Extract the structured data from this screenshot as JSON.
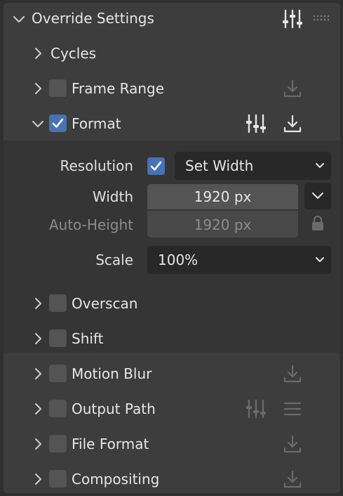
{
  "header": {
    "title": "Override Settings"
  },
  "rows": {
    "cycles": {
      "label": "Cycles"
    },
    "frame_range": {
      "label": "Frame Range"
    },
    "format": {
      "label": "Format"
    },
    "overscan": {
      "label": "Overscan"
    },
    "shift": {
      "label": "Shift"
    },
    "motion_blur": {
      "label": "Motion Blur"
    },
    "output_path": {
      "label": "Output Path"
    },
    "file_format": {
      "label": "File Format"
    },
    "compositing": {
      "label": "Compositing"
    }
  },
  "format_panel": {
    "resolution_label": "Resolution",
    "resolution_mode": "Set Width",
    "width_label": "Width",
    "width_value": "1920 px",
    "auto_height_label": "Auto-Height",
    "auto_height_value": "1920 px",
    "scale_label": "Scale",
    "scale_value": "100%"
  },
  "colors": {
    "accent": "#4772b3",
    "panel_bg": "#3d3d3d",
    "subpanel_bg": "#353535"
  },
  "icons": {
    "header_settings": "sliders-icon",
    "header_drag": "drag-handle-icon",
    "format_settings": "sliders-icon",
    "download": "download-icon",
    "list": "list-icon",
    "lock": "lock-icon"
  }
}
